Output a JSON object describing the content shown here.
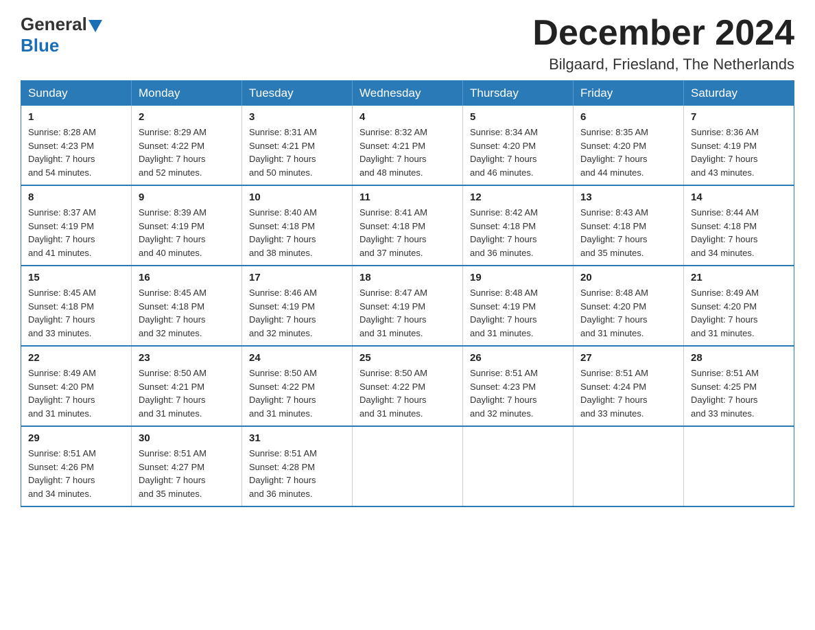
{
  "header": {
    "logo_general": "General",
    "logo_blue": "Blue",
    "title": "December 2024",
    "subtitle": "Bilgaard, Friesland, The Netherlands"
  },
  "weekdays": [
    "Sunday",
    "Monday",
    "Tuesday",
    "Wednesday",
    "Thursday",
    "Friday",
    "Saturday"
  ],
  "weeks": [
    [
      {
        "day": "1",
        "sunrise": "8:28 AM",
        "sunset": "4:23 PM",
        "daylight": "7 hours and 54 minutes."
      },
      {
        "day": "2",
        "sunrise": "8:29 AM",
        "sunset": "4:22 PM",
        "daylight": "7 hours and 52 minutes."
      },
      {
        "day": "3",
        "sunrise": "8:31 AM",
        "sunset": "4:21 PM",
        "daylight": "7 hours and 50 minutes."
      },
      {
        "day": "4",
        "sunrise": "8:32 AM",
        "sunset": "4:21 PM",
        "daylight": "7 hours and 48 minutes."
      },
      {
        "day": "5",
        "sunrise": "8:34 AM",
        "sunset": "4:20 PM",
        "daylight": "7 hours and 46 minutes."
      },
      {
        "day": "6",
        "sunrise": "8:35 AM",
        "sunset": "4:20 PM",
        "daylight": "7 hours and 44 minutes."
      },
      {
        "day": "7",
        "sunrise": "8:36 AM",
        "sunset": "4:19 PM",
        "daylight": "7 hours and 43 minutes."
      }
    ],
    [
      {
        "day": "8",
        "sunrise": "8:37 AM",
        "sunset": "4:19 PM",
        "daylight": "7 hours and 41 minutes."
      },
      {
        "day": "9",
        "sunrise": "8:39 AM",
        "sunset": "4:19 PM",
        "daylight": "7 hours and 40 minutes."
      },
      {
        "day": "10",
        "sunrise": "8:40 AM",
        "sunset": "4:18 PM",
        "daylight": "7 hours and 38 minutes."
      },
      {
        "day": "11",
        "sunrise": "8:41 AM",
        "sunset": "4:18 PM",
        "daylight": "7 hours and 37 minutes."
      },
      {
        "day": "12",
        "sunrise": "8:42 AM",
        "sunset": "4:18 PM",
        "daylight": "7 hours and 36 minutes."
      },
      {
        "day": "13",
        "sunrise": "8:43 AM",
        "sunset": "4:18 PM",
        "daylight": "7 hours and 35 minutes."
      },
      {
        "day": "14",
        "sunrise": "8:44 AM",
        "sunset": "4:18 PM",
        "daylight": "7 hours and 34 minutes."
      }
    ],
    [
      {
        "day": "15",
        "sunrise": "8:45 AM",
        "sunset": "4:18 PM",
        "daylight": "7 hours and 33 minutes."
      },
      {
        "day": "16",
        "sunrise": "8:45 AM",
        "sunset": "4:18 PM",
        "daylight": "7 hours and 32 minutes."
      },
      {
        "day": "17",
        "sunrise": "8:46 AM",
        "sunset": "4:19 PM",
        "daylight": "7 hours and 32 minutes."
      },
      {
        "day": "18",
        "sunrise": "8:47 AM",
        "sunset": "4:19 PM",
        "daylight": "7 hours and 31 minutes."
      },
      {
        "day": "19",
        "sunrise": "8:48 AM",
        "sunset": "4:19 PM",
        "daylight": "7 hours and 31 minutes."
      },
      {
        "day": "20",
        "sunrise": "8:48 AM",
        "sunset": "4:20 PM",
        "daylight": "7 hours and 31 minutes."
      },
      {
        "day": "21",
        "sunrise": "8:49 AM",
        "sunset": "4:20 PM",
        "daylight": "7 hours and 31 minutes."
      }
    ],
    [
      {
        "day": "22",
        "sunrise": "8:49 AM",
        "sunset": "4:20 PM",
        "daylight": "7 hours and 31 minutes."
      },
      {
        "day": "23",
        "sunrise": "8:50 AM",
        "sunset": "4:21 PM",
        "daylight": "7 hours and 31 minutes."
      },
      {
        "day": "24",
        "sunrise": "8:50 AM",
        "sunset": "4:22 PM",
        "daylight": "7 hours and 31 minutes."
      },
      {
        "day": "25",
        "sunrise": "8:50 AM",
        "sunset": "4:22 PM",
        "daylight": "7 hours and 31 minutes."
      },
      {
        "day": "26",
        "sunrise": "8:51 AM",
        "sunset": "4:23 PM",
        "daylight": "7 hours and 32 minutes."
      },
      {
        "day": "27",
        "sunrise": "8:51 AM",
        "sunset": "4:24 PM",
        "daylight": "7 hours and 33 minutes."
      },
      {
        "day": "28",
        "sunrise": "8:51 AM",
        "sunset": "4:25 PM",
        "daylight": "7 hours and 33 minutes."
      }
    ],
    [
      {
        "day": "29",
        "sunrise": "8:51 AM",
        "sunset": "4:26 PM",
        "daylight": "7 hours and 34 minutes."
      },
      {
        "day": "30",
        "sunrise": "8:51 AM",
        "sunset": "4:27 PM",
        "daylight": "7 hours and 35 minutes."
      },
      {
        "day": "31",
        "sunrise": "8:51 AM",
        "sunset": "4:28 PM",
        "daylight": "7 hours and 36 minutes."
      },
      null,
      null,
      null,
      null
    ]
  ],
  "labels": {
    "sunrise": "Sunrise: ",
    "sunset": "Sunset: ",
    "daylight": "Daylight: "
  }
}
